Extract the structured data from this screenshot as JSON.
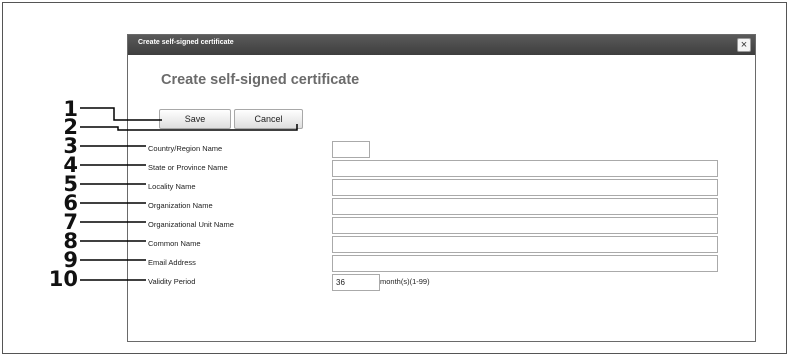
{
  "dialog": {
    "title": "Create self-signed certificate",
    "close_glyph": "×",
    "heading": "Create self-signed certificate"
  },
  "buttons": {
    "save": "Save",
    "cancel": "Cancel"
  },
  "fields": [
    {
      "label": "Country/Region Name",
      "value": ""
    },
    {
      "label": "State or Province Name",
      "value": ""
    },
    {
      "label": "Locality Name",
      "value": ""
    },
    {
      "label": "Organization Name",
      "value": ""
    },
    {
      "label": "Organizational Unit Name",
      "value": ""
    },
    {
      "label": "Common Name",
      "value": ""
    },
    {
      "label": "Email Address",
      "value": ""
    },
    {
      "label": "Validity Period",
      "value": "36",
      "unit": "month(s)(1-99)"
    }
  ],
  "callouts": [
    "1",
    "2",
    "3",
    "4",
    "5",
    "6",
    "7",
    "8",
    "9",
    "10"
  ]
}
